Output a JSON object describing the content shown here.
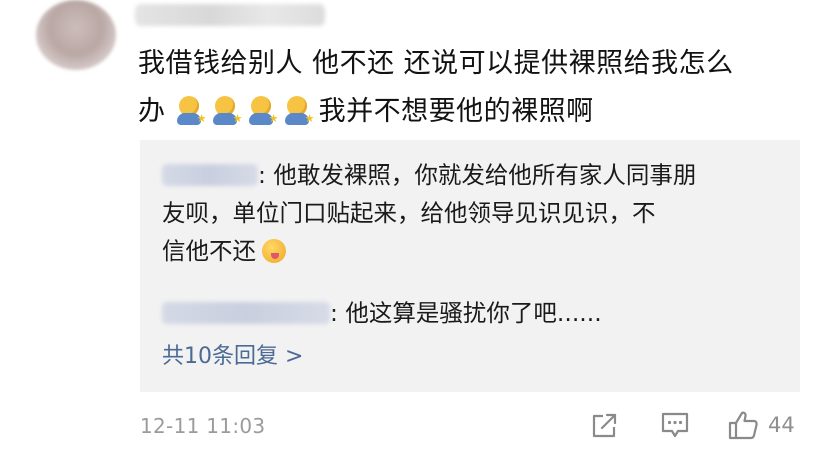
{
  "comment": {
    "post_line1": "我借钱给别人 他不还 还说可以提供裸照给我怎么",
    "post_line2_prefix": "办",
    "post_line2_suffix": "我并不想要他的裸照啊",
    "emoji": "sweat-smile-emoji",
    "timestamp": "12-11 11:03",
    "like_count": "44"
  },
  "replies": [
    {
      "line1": ": 他敢发裸照，你就发给他所有家人同事朋",
      "line2": "友呗，单位门口贴起来，给他领导见识见识，不",
      "line3": "信他不还",
      "emoji": "yum-emoji"
    },
    {
      "line1": ": 他这算是骚扰你了吧......"
    }
  ],
  "more_replies_label": "共10条回复 >",
  "icons": {
    "share": "share-icon",
    "comment": "comment-icon",
    "like": "thumbs-up-icon"
  },
  "colors": {
    "link": "#4b6a95",
    "reply_bg": "#f2f2f2",
    "meta_gray": "#9b9b9b"
  }
}
